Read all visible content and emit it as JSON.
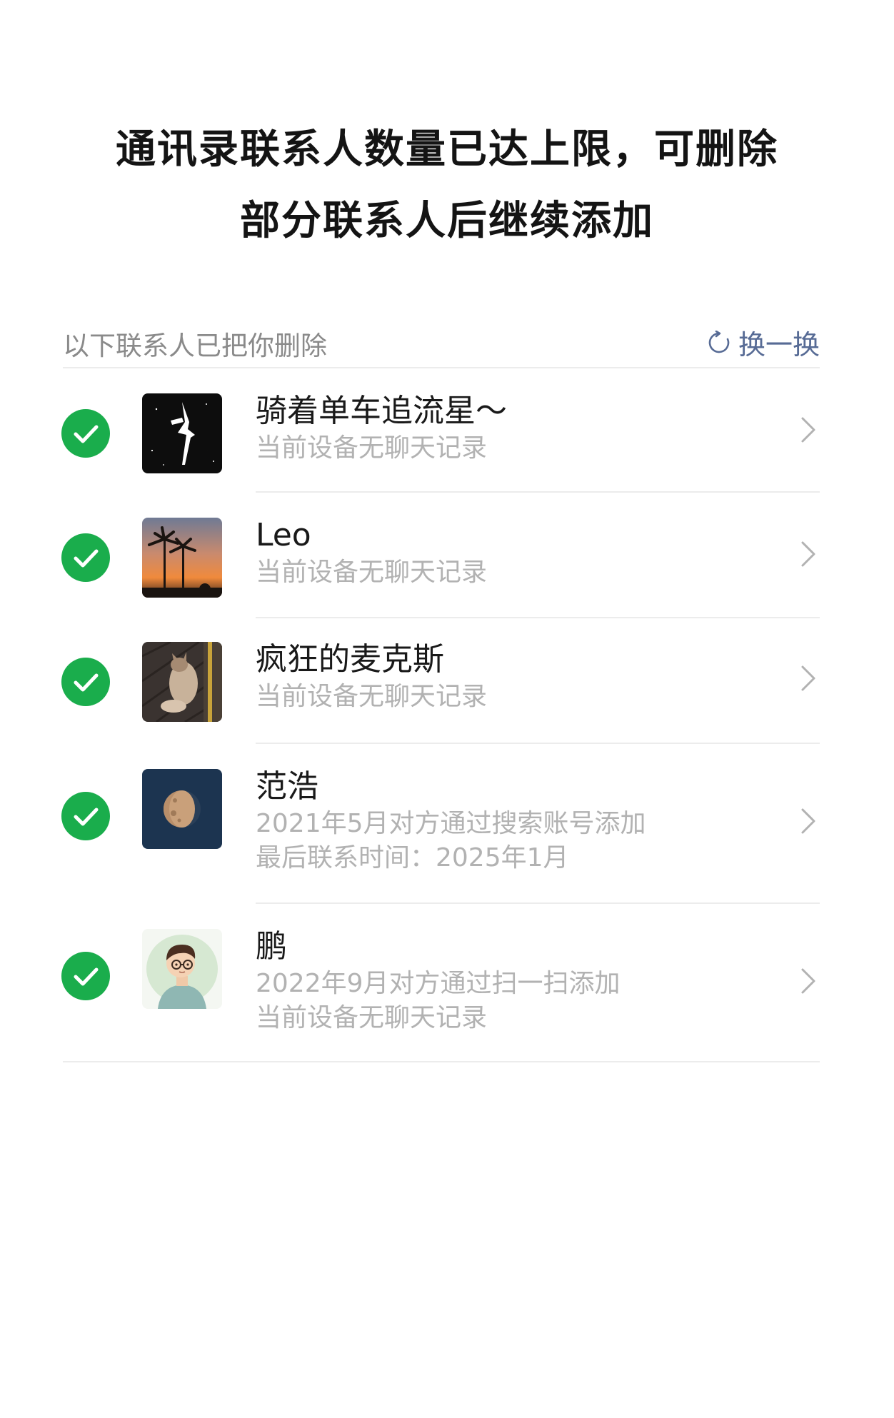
{
  "headline": {
    "line1": "通讯录联系人数量已达上限，可删除",
    "line2": "部分联系人后继续添加"
  },
  "section": {
    "title": "以下联系人已把你删除",
    "refresh_label": "换一换",
    "refresh_icon": "refresh-icon"
  },
  "colors": {
    "check_green": "#1aad4c",
    "link_blue": "#576b95",
    "subtext_gray": "#b2b2b2"
  },
  "contacts": [
    {
      "name": "骑着单车追流星～",
      "lines": [
        "当前设备无聊天记录"
      ],
      "selected": true,
      "avatar": "sailor-moon-silhouette-avatar"
    },
    {
      "name": "Leo",
      "lines": [
        "当前设备无聊天记录"
      ],
      "selected": true,
      "avatar": "palm-trees-sunset-avatar"
    },
    {
      "name": "疯狂的麦克斯",
      "lines": [
        "当前设备无聊天记录"
      ],
      "selected": true,
      "avatar": "cat-on-pavement-avatar"
    },
    {
      "name": "范浩",
      "lines": [
        "2021年5月对方通过搜索账号添加",
        "最后联系时间：2025年1月"
      ],
      "selected": true,
      "avatar": "moon-avatar"
    },
    {
      "name": "鹏",
      "lines": [
        "2022年9月对方通过扫一扫添加",
        "当前设备无聊天记录"
      ],
      "selected": true,
      "avatar": "cartoon-boy-glasses-avatar"
    }
  ]
}
